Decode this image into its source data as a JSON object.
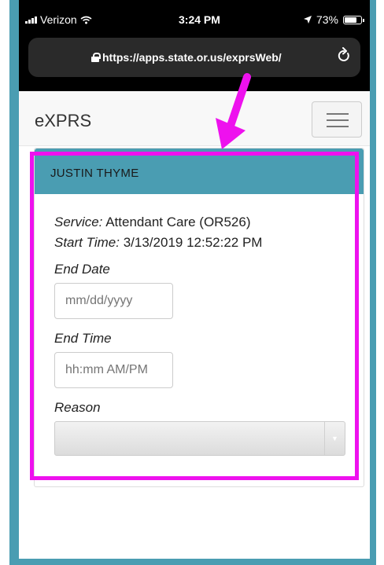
{
  "status_bar": {
    "carrier": "Verizon",
    "time": "3:24 PM",
    "battery": "73%",
    "battery_level": 0.73
  },
  "browser": {
    "url": "https://apps.state.or.us/exprsWeb/"
  },
  "navbar": {
    "brand": "eXPRS"
  },
  "panel": {
    "title": "JUSTIN THYME",
    "service_label": "Service:",
    "service_value": "Attendant Care (OR526)",
    "start_time_label": "Start Time:",
    "start_time_value": "3/13/2019 12:52:22 PM",
    "end_date_label": "End Date",
    "end_date_placeholder": "mm/dd/yyyy",
    "end_time_label": "End Time",
    "end_time_placeholder": "hh:mm AM/PM",
    "reason_label": "Reason",
    "reason_value": ""
  },
  "colors": {
    "accent": "#4a9db2",
    "highlight": "#ee11ee"
  }
}
